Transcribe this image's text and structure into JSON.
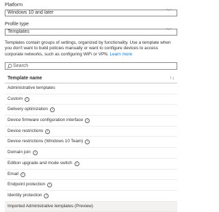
{
  "platform": {
    "label": "Platform",
    "value": "Windows 10 and later"
  },
  "profile_type": {
    "label": "Profile type",
    "value": "Templates"
  },
  "description": {
    "text": "Templates contain groups of settings, organized by functionality. Use a template when you don't want to build policies manually or want to configure devices to access corporate networks, such as configuring WiFi or VPN.",
    "link": "Learn more"
  },
  "search": {
    "placeholder": "Search"
  },
  "table": {
    "column_header": "Template name",
    "rows": [
      {
        "name": "Administrative templates",
        "info": false
      },
      {
        "name": "Custom",
        "info": true
      },
      {
        "name": "Delivery optimization",
        "info": true
      },
      {
        "name": "Device firmware configuration interface",
        "info": true
      },
      {
        "name": "Device restrictions",
        "info": true
      },
      {
        "name": "Device restrictions (Windows 10 Team)",
        "info": true
      },
      {
        "name": "Domain join",
        "info": true
      },
      {
        "name": "Edition upgrade and mode switch",
        "info": true
      },
      {
        "name": "Email",
        "info": true
      },
      {
        "name": "Endpoint protection",
        "info": true
      },
      {
        "name": "Identity protection",
        "info": true
      },
      {
        "name": "Imported Administrative templates (Preview)",
        "info": false,
        "selected": true
      }
    ]
  },
  "icons": {
    "search": "search-icon",
    "chevron": "chevron-down-icon",
    "info": "info-icon",
    "sort": "sort-arrow-icon"
  },
  "colors": {
    "link": "#0078d4",
    "border": "#8a8886",
    "selected_row": "#f3f2f1"
  }
}
